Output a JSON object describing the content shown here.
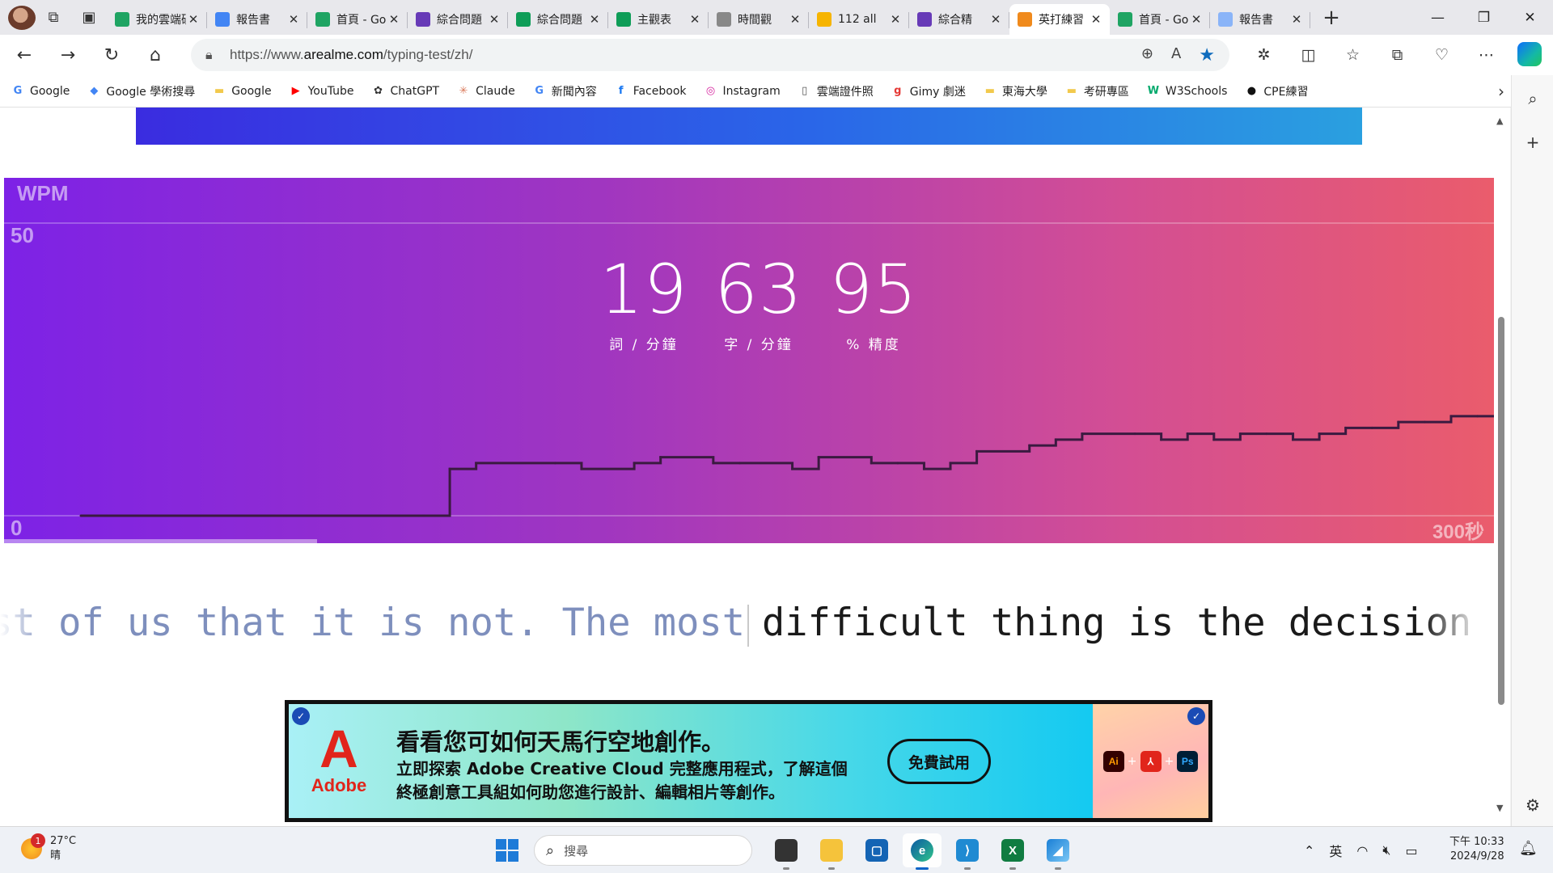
{
  "browser": {
    "tabs": [
      {
        "title": "我的雲端硬碟",
        "icon": "google-drive-icon",
        "color": "#1fa463",
        "active": false
      },
      {
        "title": "報告書",
        "icon": "google-docs-icon",
        "color": "#4285f4",
        "active": false
      },
      {
        "title": "首頁 - Google 雲端",
        "icon": "google-drive-icon",
        "color": "#1fa463",
        "active": false
      },
      {
        "title": "綜合問題",
        "icon": "google-forms-icon",
        "color": "#673ab7",
        "active": false
      },
      {
        "title": "綜合問題",
        "icon": "google-sheets-icon",
        "color": "#0f9d58",
        "active": false
      },
      {
        "title": "主觀表",
        "icon": "google-sheets-icon",
        "color": "#0f9d58",
        "active": false
      },
      {
        "title": "時間觀",
        "icon": "chatgpt-icon",
        "color": "#888888",
        "active": false
      },
      {
        "title": "112 all",
        "icon": "classroom-icon",
        "color": "#f6b400",
        "active": false
      },
      {
        "title": "綜合精",
        "icon": "google-forms-icon",
        "color": "#673ab7",
        "active": false
      },
      {
        "title": "英打練習",
        "icon": "fox-icon",
        "color": "#f08a1c",
        "active": true
      },
      {
        "title": "首頁 - Google 雲端",
        "icon": "google-drive-icon",
        "color": "#1fa463",
        "active": false
      },
      {
        "title": "報告書",
        "icon": "google-docs-icon",
        "color": "#8ab4f8",
        "active": false
      }
    ],
    "url_prefix": "https://www.",
    "url_host": "arealme.com",
    "url_path": "/typing-test/zh/",
    "bookmarks": [
      {
        "label": "Google",
        "icon": "google-icon"
      },
      {
        "label": "Google 學術搜尋",
        "icon": "scholar-icon"
      },
      {
        "label": "Google",
        "icon": "folder-icon"
      },
      {
        "label": "YouTube",
        "icon": "youtube-icon"
      },
      {
        "label": "ChatGPT",
        "icon": "chatgpt-icon"
      },
      {
        "label": "Claude",
        "icon": "claude-icon"
      },
      {
        "label": "新聞內容",
        "icon": "news-icon"
      },
      {
        "label": "Facebook",
        "icon": "facebook-icon"
      },
      {
        "label": "Instagram",
        "icon": "instagram-icon"
      },
      {
        "label": "雲端證件照",
        "icon": "page-icon"
      },
      {
        "label": "Gimy 劇迷",
        "icon": "gimy-icon"
      },
      {
        "label": "東海大學",
        "icon": "folder-icon"
      },
      {
        "label": "考研專區",
        "icon": "folder-icon"
      },
      {
        "label": "W3Schools",
        "icon": "w3schools-icon"
      },
      {
        "label": "CPE練習",
        "icon": "github-icon"
      }
    ]
  },
  "typing_test": {
    "wpm_label": "WPM",
    "words_per_min": "19",
    "words_per_min_unit": "詞 / 分鐘",
    "chars_per_min": "63",
    "chars_per_min_unit": "字 / 分鐘",
    "accuracy": "95",
    "accuracy_unit": "% 精度",
    "typed_text": "r most of us that it is not. The most",
    "remaining_text": "difficult thing is the decision to",
    "elapsed_fraction": 0.21
  },
  "chart_data": {
    "type": "line",
    "title": "WPM",
    "xlabel": "",
    "ylabel": "",
    "x_tick_labels": [
      "",
      "300秒"
    ],
    "y_tick_labels": [
      "0",
      "50"
    ],
    "xlim": [
      0,
      300
    ],
    "ylim": [
      0,
      50
    ],
    "step": true,
    "x": [
      0,
      16,
      20,
      27,
      33,
      43,
      50,
      62,
      68,
      75,
      83,
      88,
      93,
      98,
      108,
      113,
      118,
      123,
      128,
      136,
      146,
      152,
      156,
      164,
      174,
      180,
      186,
      190,
      198,
      208,
      212,
      224,
      230,
      236,
      249,
      258,
      262,
      271,
      276,
      280,
      285
    ],
    "values": [
      1,
      1,
      1,
      1,
      1,
      1,
      1,
      1,
      1,
      1,
      1,
      1,
      1,
      1,
      1,
      1,
      1,
      1,
      1,
      1,
      1,
      1,
      1,
      1,
      1,
      1,
      1,
      1,
      1,
      1,
      1,
      1,
      1,
      1,
      1,
      1,
      1,
      1,
      1,
      1,
      1
    ]
  },
  "chart_series": {
    "x": [
      0,
      65,
      70,
      75,
      90,
      95,
      105,
      110,
      120,
      125,
      135,
      140,
      150,
      155,
      160,
      165,
      170,
      180,
      185,
      190,
      200,
      205,
      210,
      215,
      220,
      225,
      230,
      235,
      240,
      245,
      250,
      255,
      260,
      265,
      270,
      275,
      278,
      282
    ],
    "values": [
      0,
      0,
      8,
      9,
      9,
      8,
      9,
      10,
      9,
      9,
      8,
      10,
      9,
      9,
      8,
      9,
      11,
      12,
      13,
      14,
      14,
      13,
      14,
      13,
      14,
      14,
      13,
      14,
      15,
      15,
      16,
      16,
      17,
      17,
      16,
      16,
      17,
      17,
      18,
      16
    ]
  },
  "ad": {
    "brand": "Adobe",
    "headline": "看看您可如何天馬行空地創作。",
    "body": "立即探索 Adobe Creative Cloud 完整應用程式，了解這個終極創意工具組如何助您進行設計、編輯相片等創作。",
    "cta": "免費試用",
    "apps": [
      "Ai",
      "Ps"
    ]
  },
  "taskbar": {
    "temperature": "27°C",
    "condition": "晴",
    "notifications": "1",
    "search_placeholder": "搜尋",
    "ime": "英",
    "time": "下午 10:33",
    "date": "2024/9/28"
  }
}
